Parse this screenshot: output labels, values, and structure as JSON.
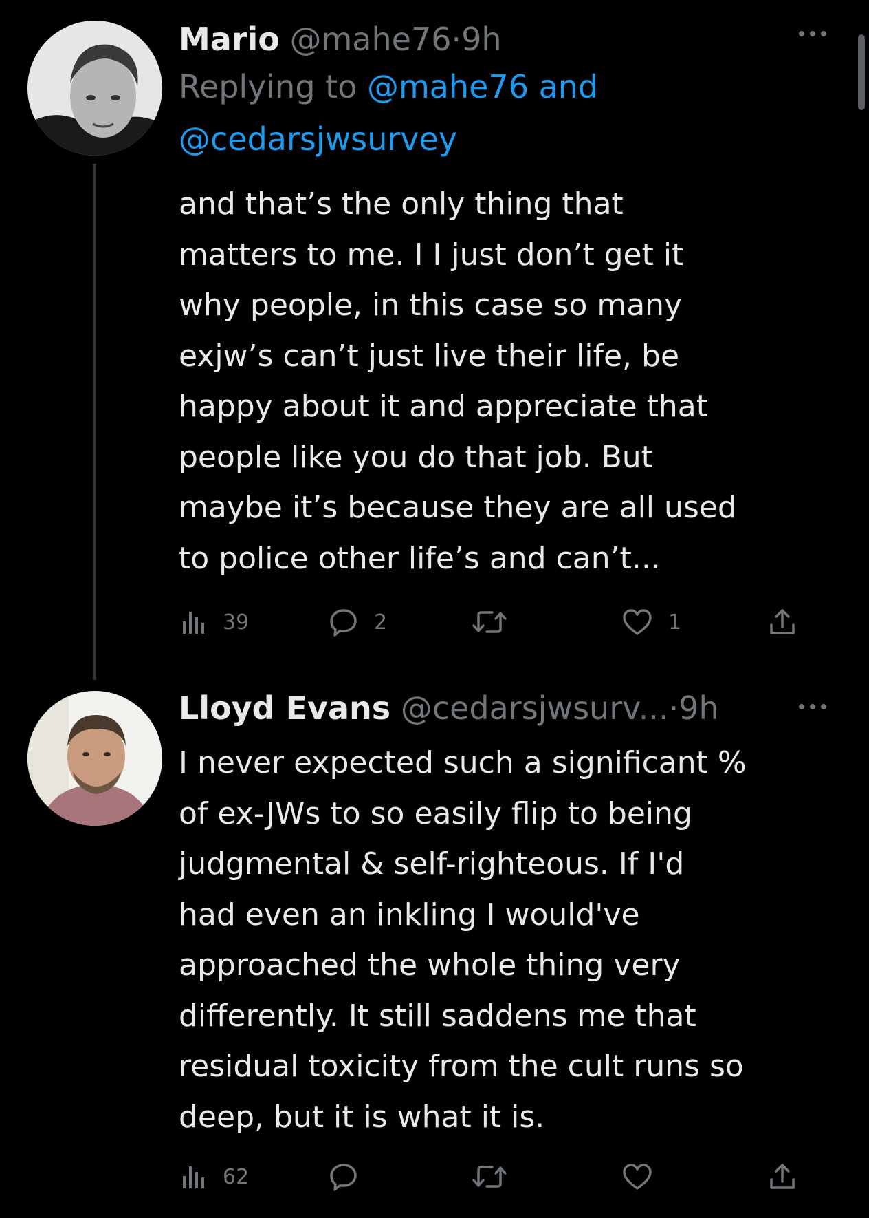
{
  "tweets": [
    {
      "name": "Mario",
      "handle": "@mahe76",
      "separator": "·",
      "time": "9h",
      "replying_to_label": "Replying to",
      "replying_to_mentions": "@mahe76 and @cedarsjwsurvey",
      "text_lines": [
        "and that’s the only thing that",
        "matters to me. I I just don’t get it",
        "why people, in this case so many",
        "exjw’s can’t just live their life, be",
        "happy about it and appreciate that",
        "people like you do that job. But",
        "maybe it’s because they are all used",
        "to police other life’s and can’t..."
      ],
      "views": "39",
      "replies": "2",
      "retweets": "",
      "likes": "1",
      "more_icon": "more-dots-icon"
    },
    {
      "name": "Lloyd Evans",
      "handle": "@cedarsjwsurv...",
      "separator": "·",
      "time": "9h",
      "text_lines": [
        "I never expected such a significant %",
        "of ex-JWs to so easily flip to being",
        "judgmental & self-righteous. If I'd",
        "had even an inkling I would've",
        "approached the whole thing very",
        "differently. It still saddens me that",
        "residual toxicity from the cult runs so",
        "deep, but it is what it is."
      ],
      "views": "62",
      "replies": "",
      "retweets": "",
      "likes": "",
      "more_icon": "more-dots-icon"
    }
  ],
  "colors": {
    "background": "#000000",
    "text": "#e7e9ea",
    "secondary": "#71767b",
    "link": "#1d9bf0"
  }
}
